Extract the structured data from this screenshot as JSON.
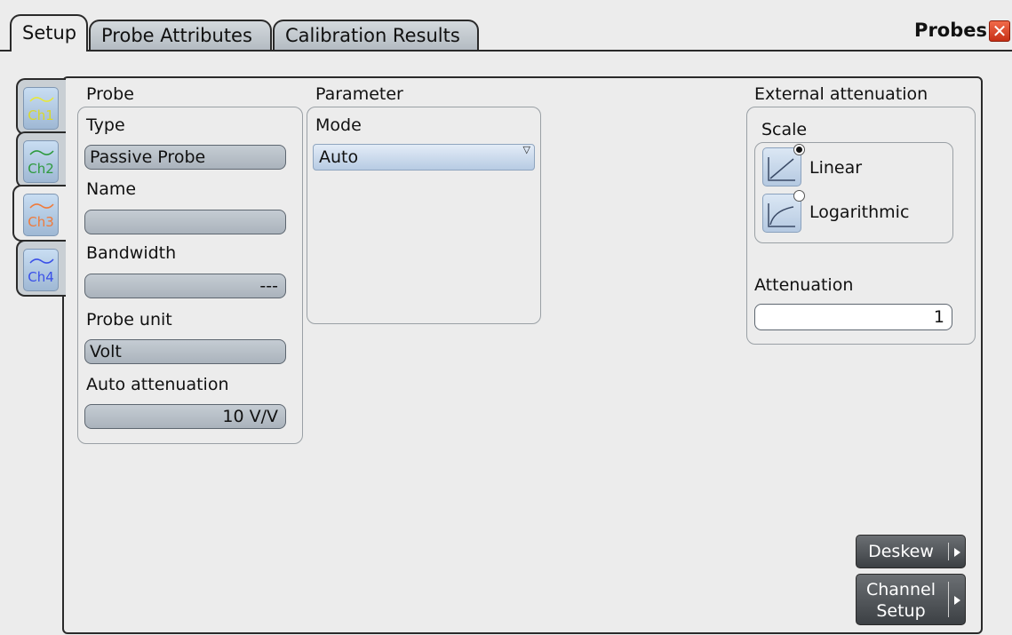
{
  "tabs": [
    {
      "label": "Setup",
      "active": true
    },
    {
      "label": "Probe Attributes",
      "active": false
    },
    {
      "label": "Calibration Results",
      "active": false
    }
  ],
  "dialog": {
    "title": "Probes",
    "close_glyph": "✕"
  },
  "channels": [
    {
      "label": "Ch1",
      "color": "#e8e83a",
      "active": false
    },
    {
      "label": "Ch2",
      "color": "#2e9a3e",
      "active": false
    },
    {
      "label": "Ch3",
      "color": "#f07a3a",
      "active": true
    },
    {
      "label": "Ch4",
      "color": "#3a50e8",
      "active": false
    }
  ],
  "probe": {
    "title": "Probe",
    "type_label": "Type",
    "type_value": "Passive Probe",
    "name_label": "Name",
    "name_value": "",
    "bandwidth_label": "Bandwidth",
    "bandwidth_value": "---",
    "unit_label": "Probe unit",
    "unit_value": "Volt",
    "auto_att_label": "Auto attenuation",
    "auto_att_value": "10 V/V"
  },
  "parameter": {
    "title": "Parameter",
    "mode_label": "Mode",
    "mode_value": "Auto"
  },
  "external": {
    "title": "External attenuation",
    "scale_label": "Scale",
    "options": [
      {
        "label": "Linear",
        "selected": true,
        "icon": "linear-scale-icon"
      },
      {
        "label": "Logarithmic",
        "selected": false,
        "icon": "log-scale-icon"
      }
    ],
    "attenuation_label": "Attenuation",
    "attenuation_value": "1"
  },
  "buttons": {
    "deskew": "Deskew",
    "channel_setup_line1": "Channel",
    "channel_setup_line2": "Setup"
  }
}
